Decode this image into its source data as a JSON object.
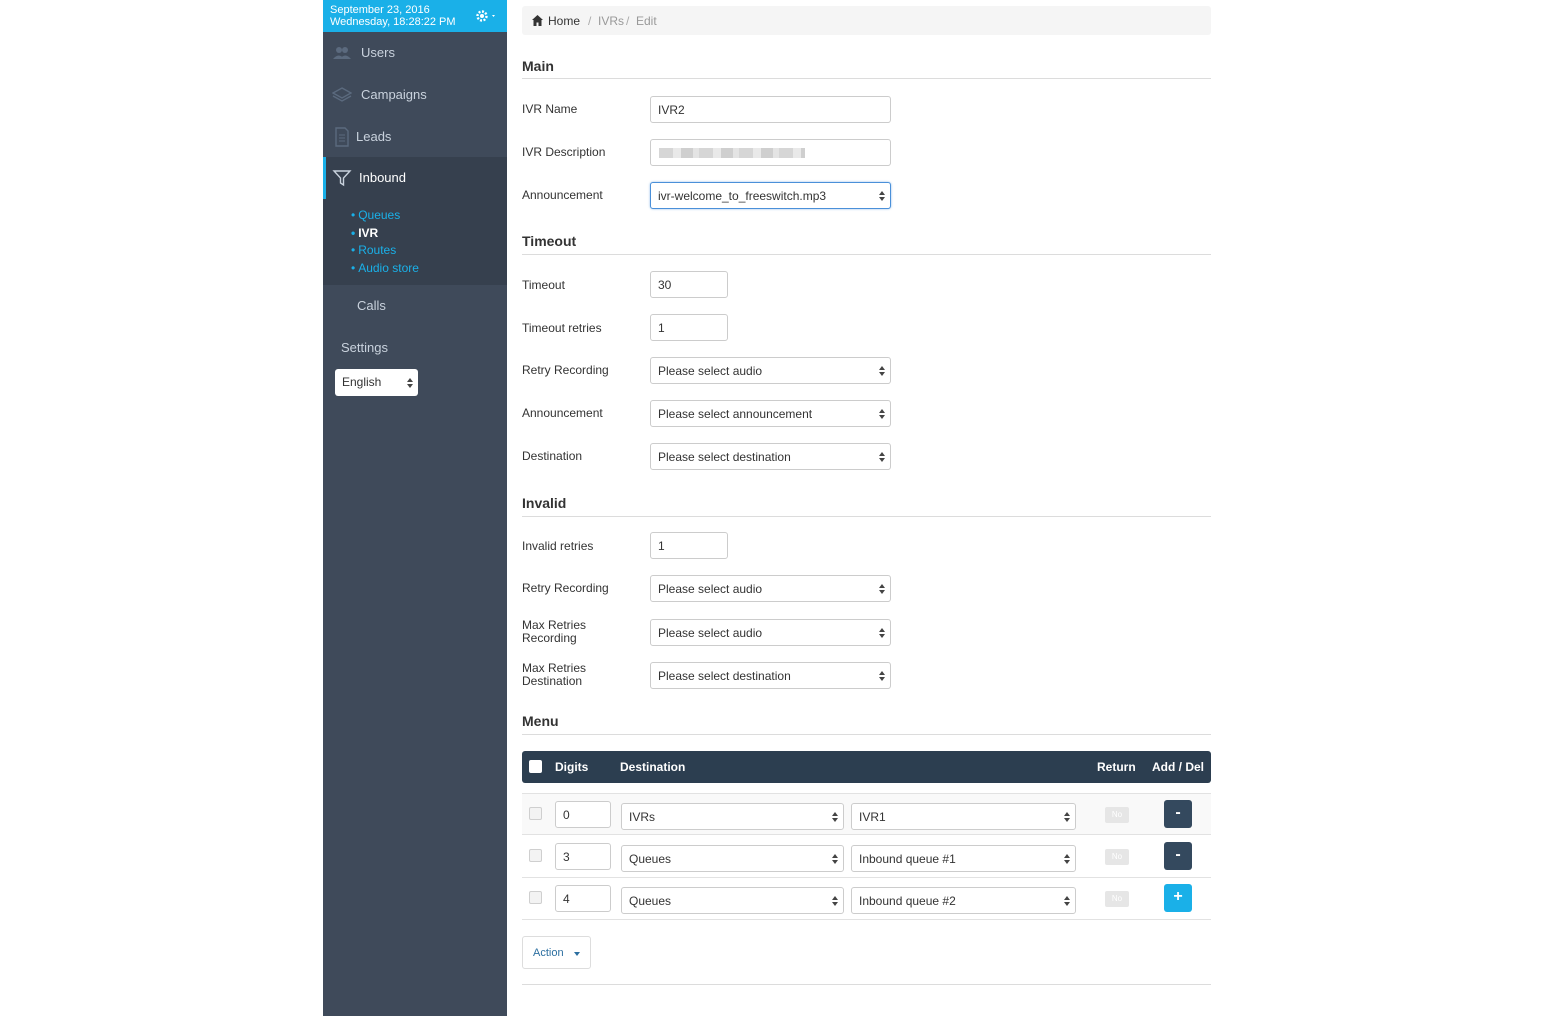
{
  "header": {
    "date": "September 23, 2016",
    "datetime": "Wednesday, 18:28:22 PM"
  },
  "sidebar": {
    "items": [
      {
        "label": "Users",
        "icon": "users-icon"
      },
      {
        "label": "Campaigns",
        "icon": "layers-icon"
      },
      {
        "label": "Leads",
        "icon": "document-icon"
      },
      {
        "label": "Inbound",
        "icon": "funnel-icon"
      },
      {
        "label": "Calls"
      },
      {
        "label": "Settings"
      }
    ],
    "submenu": [
      "Queues",
      "IVR",
      "Routes",
      "Audio store"
    ],
    "language": "English"
  },
  "breadcrumb": [
    "Home",
    "IVRs",
    "Edit"
  ],
  "main": {
    "title": "Main",
    "ivr_name_label": "IVR Name",
    "ivr_name": "IVR2",
    "ivr_description_label": "IVR Description",
    "announcement_label": "Announcement",
    "announcement": "ivr-welcome_to_freeswitch.mp3"
  },
  "timeout": {
    "title": "Timeout",
    "timeout_label": "Timeout",
    "timeout": "30",
    "retries_label": "Timeout retries",
    "retries": "1",
    "retry_recording_label": "Retry Recording",
    "retry_recording": "Please select audio",
    "announcement_label": "Announcement",
    "announcement": "Please select announcement",
    "destination_label": "Destination",
    "destination": "Please select destination"
  },
  "invalid": {
    "title": "Invalid",
    "retries_label": "Invalid retries",
    "retries": "1",
    "retry_recording_label": "Retry Recording",
    "retry_recording": "Please select audio",
    "max_retries_recording_label1": "Max Retries",
    "max_retries_recording_label2": "Recording",
    "max_retries_recording": "Please select audio",
    "max_retries_destination_label1": "Max Retries",
    "max_retries_destination_label2": "Destination",
    "max_retries_destination": "Please select destination"
  },
  "menu": {
    "title": "Menu",
    "columns": [
      "Digits",
      "Destination",
      "Return",
      "Add / Del"
    ],
    "rows": [
      {
        "digit": "0",
        "type": "IVRs",
        "target": "IVR1",
        "return": "No",
        "action": "-"
      },
      {
        "digit": "3",
        "type": "Queues",
        "target": "Inbound queue #1",
        "return": "No",
        "action": "-"
      },
      {
        "digit": "4",
        "type": "Queues",
        "target": "Inbound queue #2",
        "return": "No",
        "action": "+"
      }
    ],
    "action_label": "Action"
  },
  "colors": {
    "sidebar": "#3f4a5a",
    "accent": "#1ab0e8",
    "table_header": "#2c3e50"
  }
}
